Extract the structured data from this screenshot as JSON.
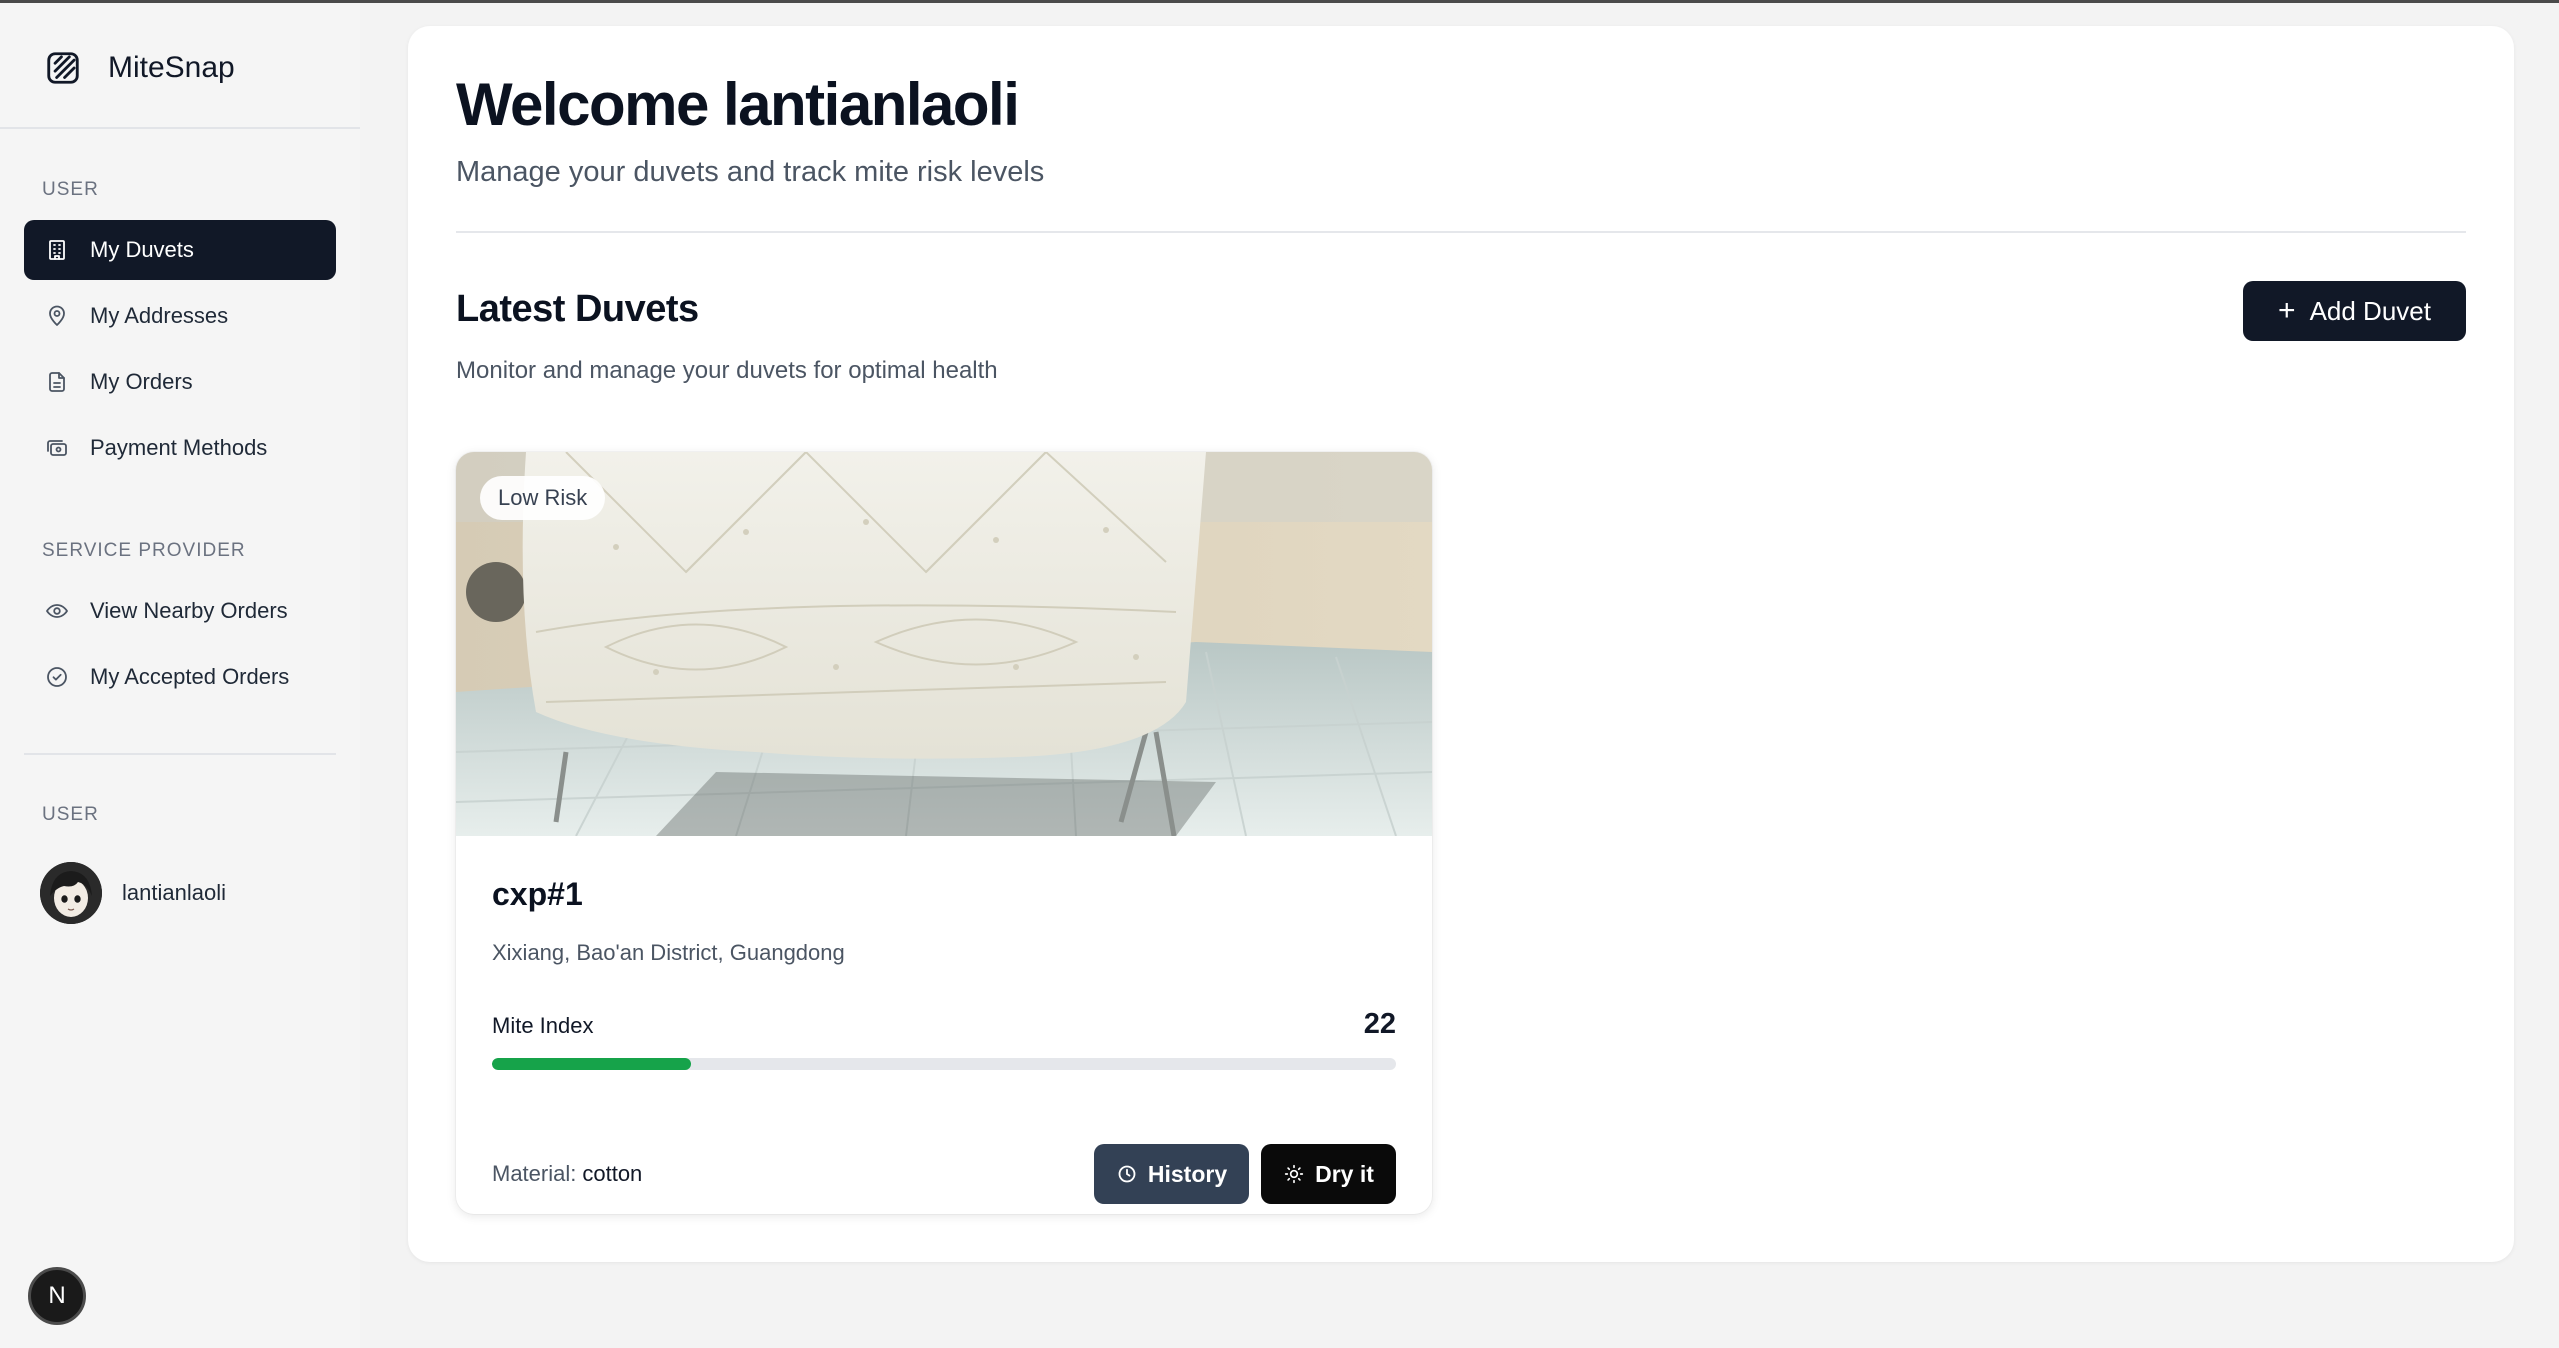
{
  "app": {
    "name": "MiteSnap",
    "logo_icon": "mitesnap-logo-icon"
  },
  "sidebar": {
    "user_section_label": "USER",
    "user_items": [
      {
        "label": "My Duvets",
        "icon": "building-icon",
        "active": true
      },
      {
        "label": "My Addresses",
        "icon": "map-pin-icon",
        "active": false
      },
      {
        "label": "My Orders",
        "icon": "document-icon",
        "active": false
      },
      {
        "label": "Payment Methods",
        "icon": "payment-icon",
        "active": false
      }
    ],
    "provider_section_label": "SERVICE PROVIDER",
    "provider_items": [
      {
        "label": "View Nearby Orders",
        "icon": "eye-icon"
      },
      {
        "label": "My Accepted Orders",
        "icon": "check-circle-icon"
      }
    ],
    "account_section_label": "USER",
    "account": {
      "username": "lantianlaoli",
      "avatar": "avatar-image"
    },
    "dev_badge": "N"
  },
  "main": {
    "title": "Welcome lantianlaoli",
    "subtitle": "Manage your duvets and track mite risk levels",
    "section_title": "Latest Duvets",
    "section_subtitle": "Monitor and manage your duvets for optimal health",
    "add_button_label": "Add Duvet",
    "duvets": [
      {
        "risk_badge": "Low Risk",
        "name": "cxp#1",
        "address": "Xixiang, Bao'an District, Guangdong",
        "mite_index_label": "Mite Index",
        "mite_index_value": "22",
        "mite_index_fraction": 0.22,
        "material_label": "Material:",
        "material_value": "cotton",
        "history_label": "History",
        "dry_label": "Dry it"
      }
    ]
  },
  "colors": {
    "accent_dark": "#111827",
    "progress_fill": "#16a34a",
    "history_button": "#334155"
  }
}
